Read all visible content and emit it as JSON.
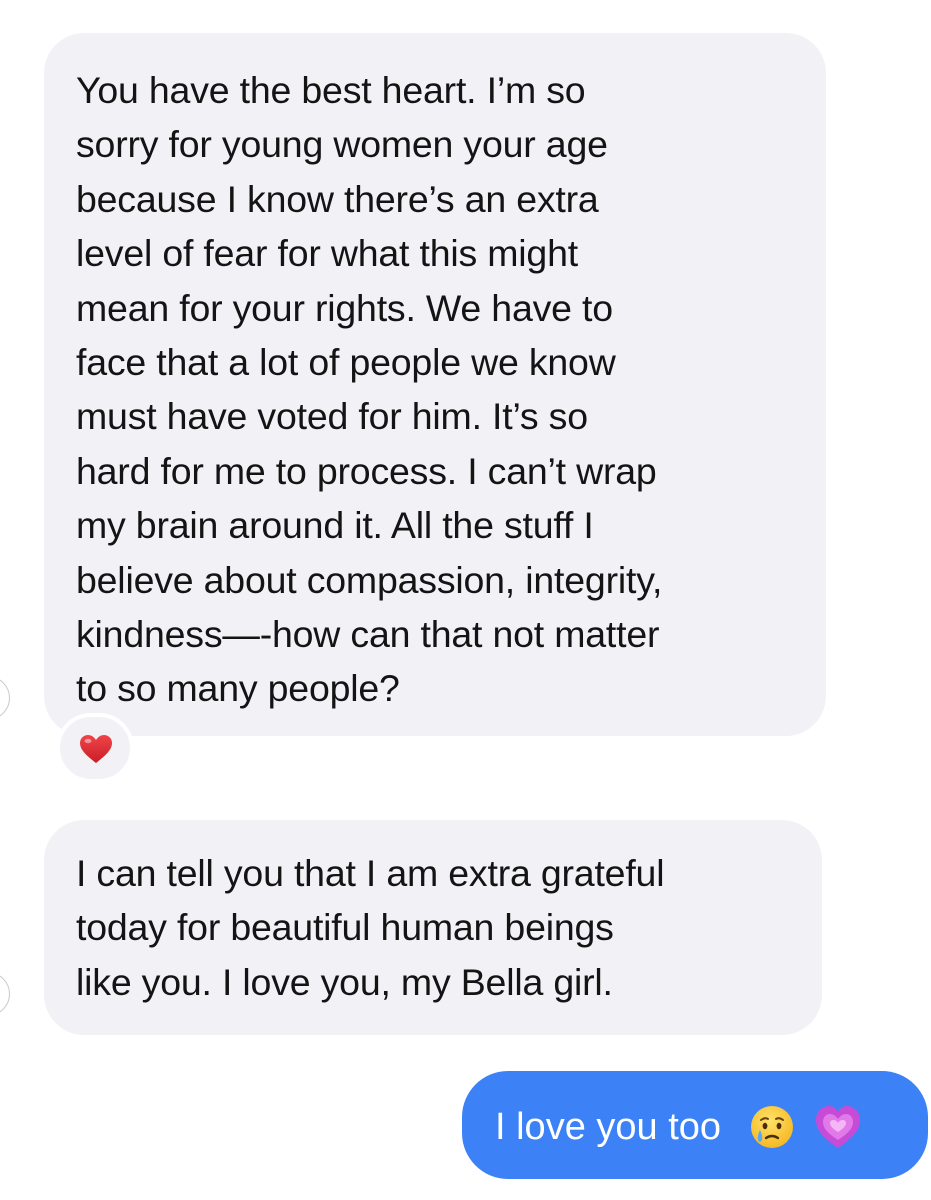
{
  "conversation": {
    "messages": [
      {
        "direction": "incoming",
        "lines": [
          "You have the best heart. I’m so",
          "sorry for young women your age",
          "because I know there’s an extra",
          "level of fear for what this might",
          "mean for your rights. We have to",
          "face that a lot of people we know",
          "must have voted for him. It’s so",
          "hard for me to process. I can’t wrap",
          "my brain around it. All the stuff I",
          "believe about compassion, integrity,",
          "kindness—-how can that not matter",
          "to so many people?"
        ],
        "reaction": {
          "icon": "red-heart-icon",
          "color": "#e0282e"
        }
      },
      {
        "direction": "incoming",
        "lines": [
          "I can tell you that I am extra grateful",
          "today for beautiful human beings",
          "like you. I love you, my Bella girl."
        ]
      },
      {
        "direction": "outgoing",
        "text": "I love you too",
        "emojis": [
          "crying-face-icon",
          "growing-heart-icon"
        ]
      }
    ]
  },
  "colors": {
    "incoming_bubble": "#f2f2f6",
    "outgoing_bubble": "#3c82f6",
    "text_dark": "#141414",
    "text_light": "#ffffff"
  }
}
